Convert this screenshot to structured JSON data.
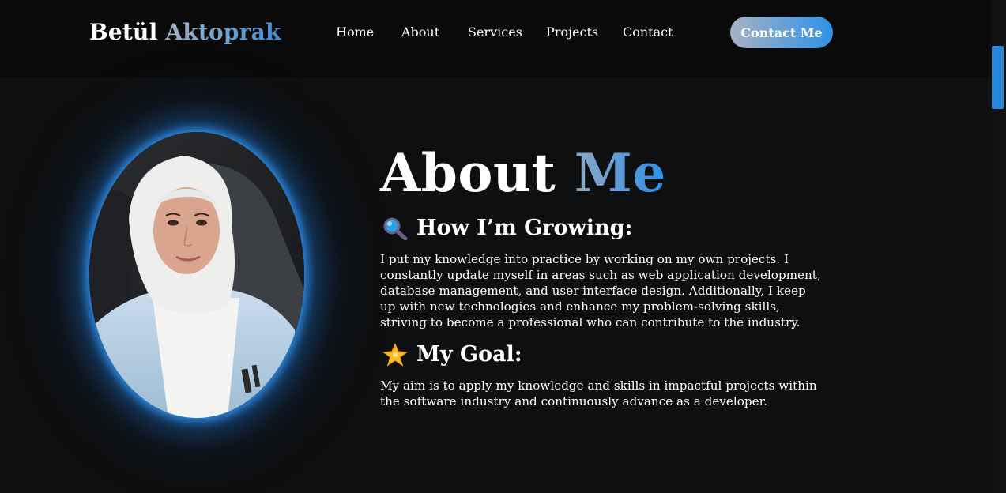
{
  "header": {
    "logo_first": "Betül",
    "logo_last": "Aktoprak",
    "nav": [
      {
        "label": "Home"
      },
      {
        "label": "About"
      },
      {
        "label": "Services"
      },
      {
        "label": "Projects"
      },
      {
        "label": "Contact"
      }
    ],
    "cta_label": "Contact Me"
  },
  "about": {
    "title_main": "About",
    "title_accent": "Me",
    "growing": {
      "icon": "magnifying-glass-icon",
      "heading": "How I’m Growing:",
      "text": "I put my knowledge into practice by working on my own projects. I constantly update myself in areas such as web application development, database management, and user interface design. Additionally, I keep up with new technologies and enhance my problem-solving skills, striving to become a professional who can contribute to the industry."
    },
    "goal": {
      "icon": "glowing-star-icon",
      "heading": "My Goal:",
      "text": "My aim is to apply my knowledge and skills in impactful projects within the software industry and continuously advance as a developer."
    }
  },
  "colors": {
    "background": "#0e0f10",
    "header_bg": "#0a0a0a",
    "accent_blue": "#2d8fe8",
    "accent_gray": "#a6b3c4"
  }
}
